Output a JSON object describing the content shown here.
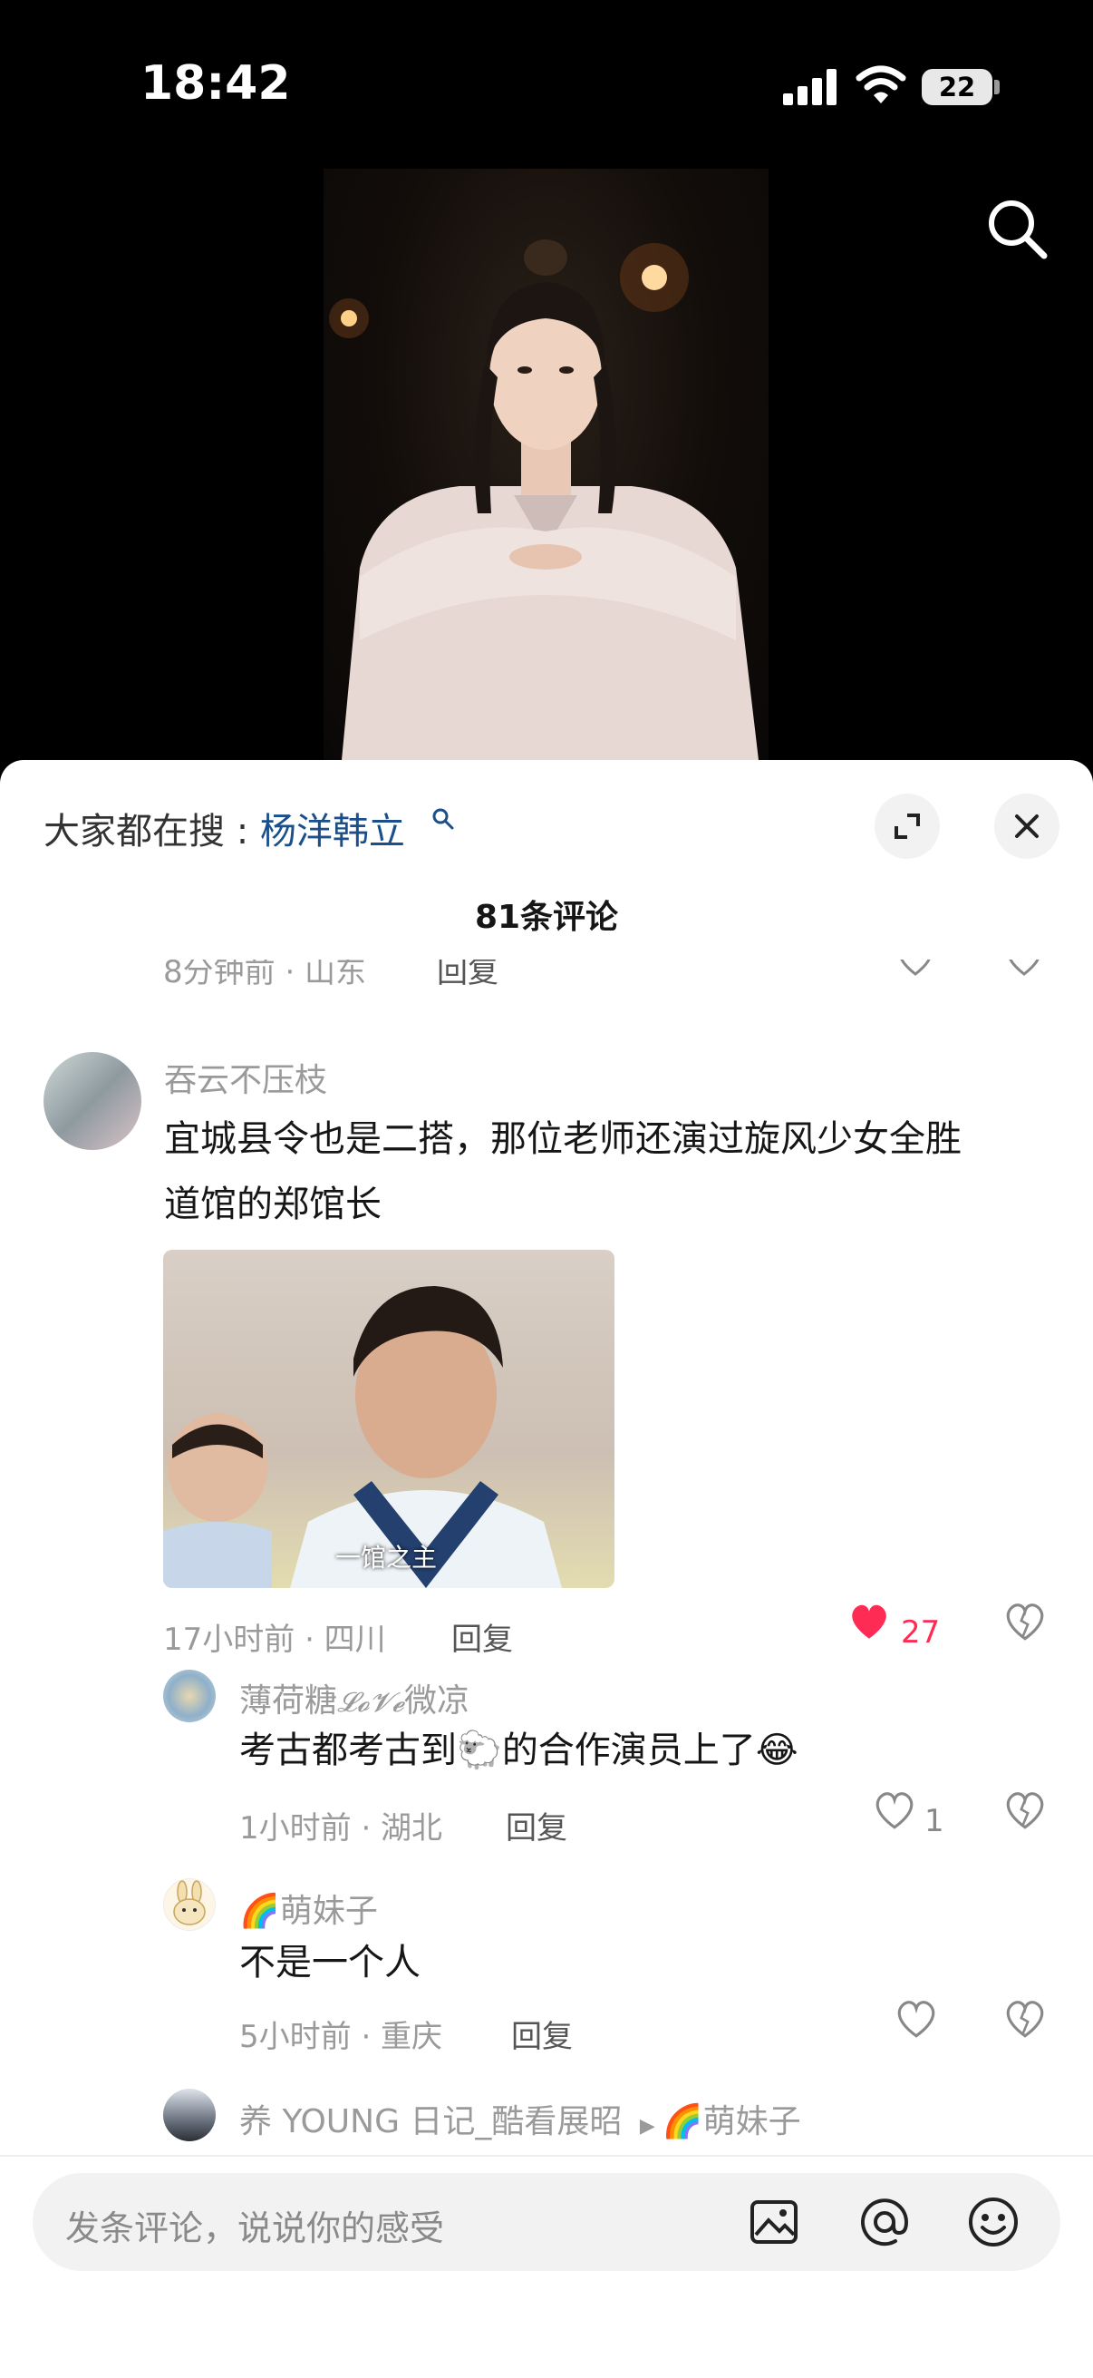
{
  "status_bar": {
    "time": "18:42",
    "battery": "22"
  },
  "search_banner": {
    "prefix": "大家都在搜 : ",
    "keyword": "杨洋韩立"
  },
  "comments_count": "81条评论",
  "partial_row": {
    "meta": "8分钟前 · 山东",
    "reply": "回复"
  },
  "comment": {
    "author": "吞云不压枝",
    "text_line1": "宜城县令也是二搭，那位老师还演过旋风少女全胜",
    "text_line2": "道馆的郑馆长",
    "image_caption": "一馆之主",
    "meta": "17小时前 · 四川",
    "reply": "回复",
    "likes": "27"
  },
  "replies": [
    {
      "author_a": "薄荷糖",
      "author_b": "𝓛𝓸𝓥𝓮",
      "author_c": "微凉",
      "text_a": "考古都考古到",
      "text_b": "的合作演员上了",
      "emoji_a": "🐑",
      "emoji_b": "😂",
      "meta": "1小时前 · 湖北",
      "reply": "回复",
      "likes": "1"
    },
    {
      "author_emoji": "🌈",
      "author": "萌妹子",
      "text": "不是一个人",
      "meta": "5小时前 · 重庆",
      "reply": "回复"
    },
    {
      "author": "养 YOUNG 日记_酷看展昭",
      "reply_to_emoji": "🌈",
      "reply_to": "萌妹子"
    }
  ],
  "input": {
    "placeholder": "发条评论，说说你的感受"
  },
  "colors": {
    "accent_blue": "#1a4f8c",
    "like_red": "#fe2c55",
    "text": "#161616",
    "meta_grey": "#9a9a9a"
  }
}
